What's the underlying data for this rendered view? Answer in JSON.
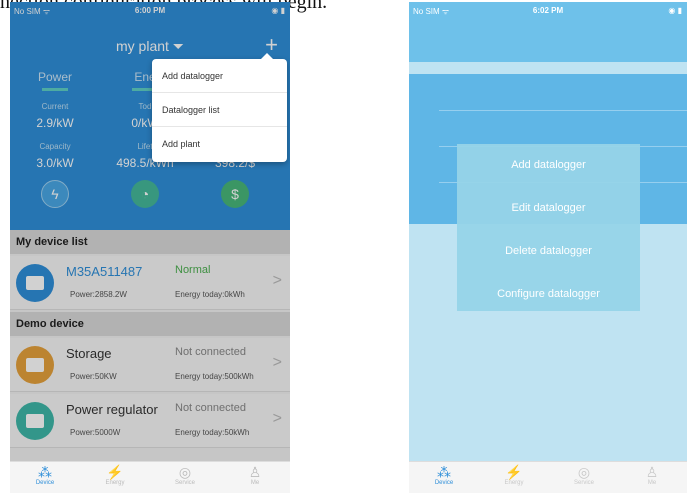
{
  "caption": "nection configuration process will begin.",
  "phone1": {
    "status": {
      "carrier": "No SIM ᯤ",
      "time": "6:00 PM",
      "battery": "◉ ▮"
    },
    "title": "my plant ⏷",
    "add_symbol": "+",
    "tabs": [
      "Power",
      "Ene"
    ],
    "stats": {
      "current_label": "Current",
      "current_value": "2.9/kW",
      "today_label": "Tod",
      "today_value": "0/kW",
      "capacity_label": "Capacity",
      "capacity_value": "3.0/kW",
      "lifetime_label": "Lifet",
      "lifetime_value": "498.5/kWh",
      "revenue_value": "398.2/$"
    },
    "dropdown": [
      "Add datalogger",
      "Datalogger list",
      "Add plant"
    ],
    "my_device_list": "My device list",
    "devices": [
      {
        "name": "M35A511487",
        "state": "Normal",
        "power": "Power:2858.2W",
        "energy": "Energy today:0kWh",
        "color": "#2f8fd9"
      }
    ],
    "demo_device": "Demo device",
    "demo_devices": [
      {
        "name": "Storage",
        "state": "Not connected",
        "power": "Power:50KW",
        "energy": "Energy today:500kWh",
        "color": "#e6a23c"
      },
      {
        "name": "Power regulator",
        "state": "Not connected",
        "power": "Power:5000W",
        "energy": "Energy today:50kWh",
        "color": "#3fb8a9"
      }
    ],
    "nav": [
      "Device",
      "Energy",
      "Service",
      "Me"
    ]
  },
  "phone2": {
    "status": {
      "carrier": "No SIM ᯤ",
      "time": "6:02 PM",
      "battery": "◉ ▮"
    },
    "menu": [
      "Add datalogger",
      "Edit datalogger",
      "Delete datalogger",
      "Configure datalogger"
    ],
    "nav": [
      "Device",
      "Energy",
      "Service",
      "Me"
    ]
  }
}
